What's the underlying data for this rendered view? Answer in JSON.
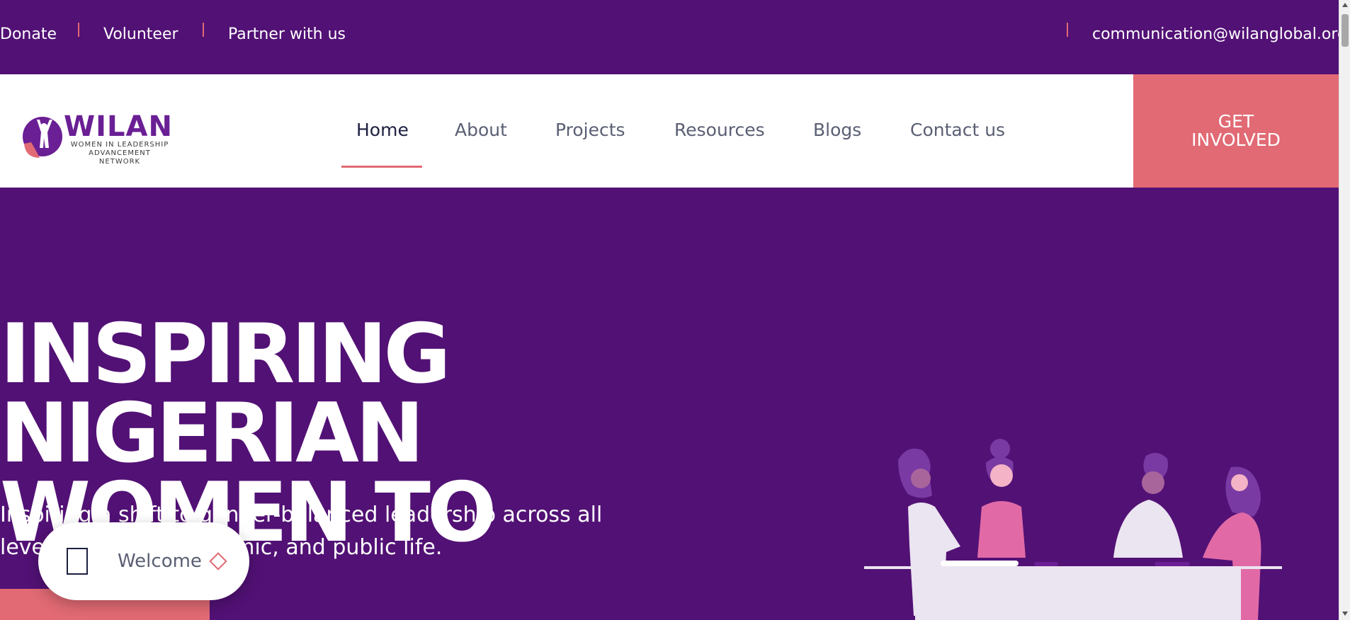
{
  "topbar": {
    "links": [
      "Donate",
      "Volunteer",
      "Partner with us"
    ],
    "email": "communication@wilanglobal.org"
  },
  "logo": {
    "word": "WILAN",
    "subtitle_line1": "WOMEN IN LEADERSHIP",
    "subtitle_line2": "ADVANCEMENT NETWORK"
  },
  "nav": {
    "items": [
      "Home",
      "About",
      "Projects",
      "Resources",
      "Blogs",
      "Contact us"
    ],
    "active": "Home"
  },
  "cta": {
    "line1": "GET",
    "line2": "INVOLVED"
  },
  "hero": {
    "title_line1": "INSPIRING NIGERIAN",
    "title_line2": "WOMEN TO",
    "subtitle_line1": "Inspiring a shift to gender-balanced leadership across all",
    "subtitle_line2": "levels of social, economic, and public life."
  },
  "welcome": {
    "label": "Welcome"
  },
  "colors": {
    "brand_purple": "#521175",
    "accent_coral": "#e16a74",
    "white": "#ffffff",
    "nav_text": "#5a5f73"
  }
}
